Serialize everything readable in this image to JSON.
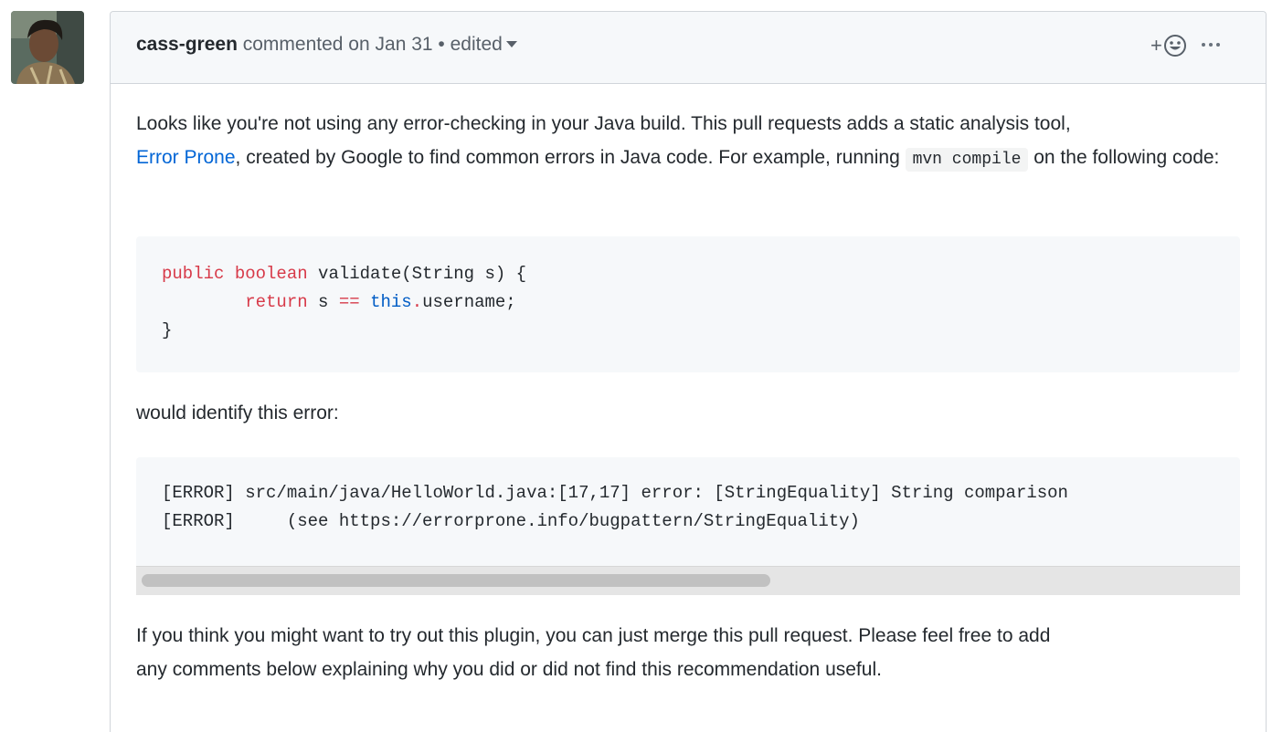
{
  "comment": {
    "author": "cass-green",
    "action": "commented on",
    "date": "Jan 31",
    "separator": "•",
    "edited": "edited",
    "reaction_plus": "+",
    "body": {
      "para1_part1": "Looks like you're not using any error-checking in your Java build. This pull requests adds a static analysis tool,",
      "link_text": "Error Prone",
      "para1_part2": ", created by Google to find common errors in Java code. For example, running ",
      "inline_code": "mvn compile",
      "para1_part3": " on the following code:",
      "code1": {
        "line1_kw": "public boolean",
        "line1_rest": " validate(String s) {",
        "line2_indent": "        ",
        "line2_kw": "return",
        "line2_mid": " s ",
        "line2_op": "==",
        "line2_sp": " ",
        "line2_this": "this",
        "line2_dot": ".",
        "line2_rest": "username;",
        "line3": "}"
      },
      "para2": "would identify this error:",
      "code2": {
        "line1": "[ERROR] src/main/java/HelloWorld.java:[17,17] error: [StringEquality] String comparison",
        "line2": "[ERROR]     (see https://errorprone.info/bugpattern/StringEquality)"
      },
      "para3_line1": "If you think you might want to try out this plugin, you can just merge this pull request. Please feel free to add",
      "para3_line2": "any comments below explaining why you did or did not find this recommendation useful."
    }
  }
}
